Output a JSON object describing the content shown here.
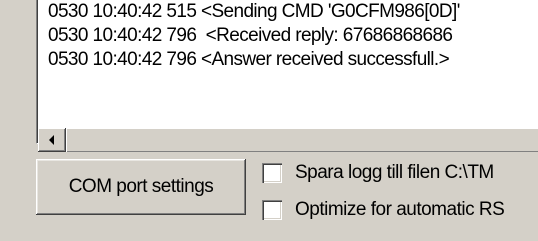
{
  "log": {
    "lines": [
      "0530 10:40:42 515 <Sending CMD 'G0CFM986[0D]'",
      "0530 10:40:42 796  <Received reply: 67686868686",
      "0530 10:40:42 796 <Answer received successfull.>"
    ]
  },
  "scrollbar": {
    "left_arrow_icon": "left-arrow-icon"
  },
  "buttons": {
    "com_port_settings": "COM port settings"
  },
  "options": {
    "save_log": {
      "label": "Spara logg till filen C:\\TM",
      "checked": false
    },
    "optimize": {
      "label": "Optimize for automatic RS",
      "checked": false
    }
  },
  "colors": {
    "face": "#d4d0c8",
    "window": "#ffffff",
    "text": "#000000"
  }
}
